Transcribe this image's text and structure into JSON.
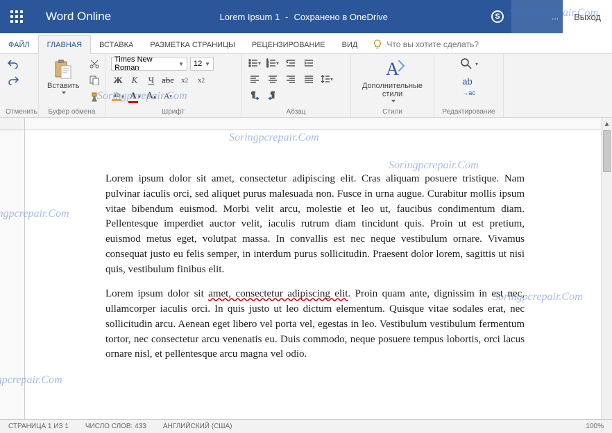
{
  "titlebar": {
    "app_name": "Word Online",
    "doc_name": "Lorem Ipsum 1",
    "separator": "-",
    "saved_text": "Сохранено в OneDrive",
    "user_menu": "...",
    "exit": "Выход"
  },
  "tabs": {
    "file": "ФАЙЛ",
    "home": "ГЛАВНАЯ",
    "insert": "ВСТАВКА",
    "layout": "РАЗМЕТКА СТРАНИЦЫ",
    "review": "РЕЦЕНЗИРОВАНИЕ",
    "view": "ВИД",
    "tellme_placeholder": "Что вы хотите сделать?"
  },
  "ribbon": {
    "undo_group": "Отменить",
    "clipboard_group": "Буфер обмена",
    "paste": "Вставить",
    "font_group": "Шрифт",
    "font_name": "Times New Roman",
    "font_size": "12",
    "paragraph_group": "Абзац",
    "styles_group": "Стили",
    "styles_button": "Дополнительные стили",
    "editing_group": "Редактирование",
    "replace_glyph": "ab"
  },
  "document": {
    "para1": "Lorem ipsum dolor sit amet, consectetur adipiscing elit. Cras aliquam posuere tristique. Nam pulvinar iaculis orci, sed aliquet purus malesuada non. Fusce in urna augue. Curabitur mollis ipsum vitae bibendum euismod. Morbi velit arcu, molestie et leo ut, faucibus condimentum diam. Pellentesque imperdiet auctor velit, iaculis rutrum diam tincidunt quis. Proin ut est pretium, euismod metus eget, volutpat massa. In convallis est nec neque vestibulum ornare. Vivamus consequat justo eu felis semper, in interdum purus sollicitudin. Praesent dolor lorem, sagittis ut nisi quis, vestibulum finibus elit.",
    "para2_pre": "Lorem ipsum dolor sit ",
    "para2_err": "amet, consectetur adipiscing elit",
    "para2_post": ". Proin quam ante, dignissim in est nec, ullamcorper iaculis orci. In quis justo ut leo dictum elementum. Quisque vitae sodales erat, nec sollicitudin arcu. Aenean eget libero vel porta vel, egestas in leo. Vestibulum vestibulum fermentum tortor, nec consectetur arcu venenatis eu. Duis commodo, neque posuere tempus lobortis, orci lacus ornare nisl, et pellentesque arcu magna vel odio."
  },
  "statusbar": {
    "page": "СТРАНИЦА 1 ИЗ 1",
    "words": "ЧИСЛО СЛОВ: 433",
    "language": "АНГЛИЙСКИЙ (США)",
    "zoom": "100%"
  },
  "watermark_text": "Soringpcrepair.Com"
}
